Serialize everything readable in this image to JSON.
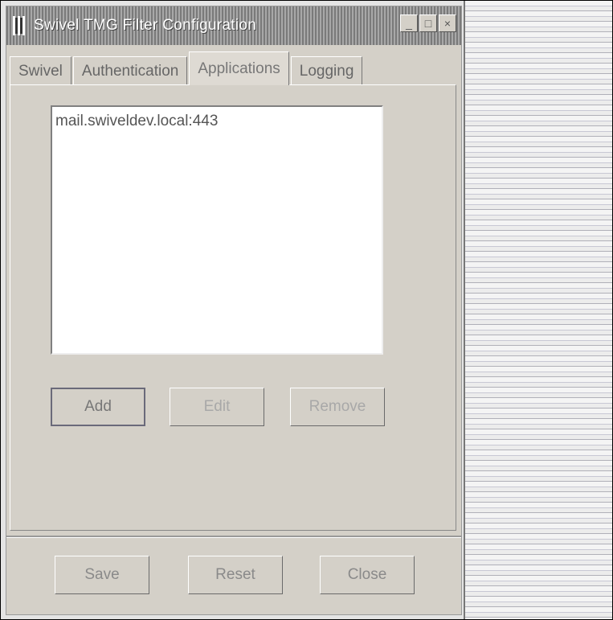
{
  "window": {
    "title": "Swivel TMG Filter Configuration",
    "controls": {
      "minimize": "_",
      "maximize": "□",
      "close": "×"
    }
  },
  "tabs": [
    {
      "label": "Swivel",
      "active": false
    },
    {
      "label": "Authentication",
      "active": false
    },
    {
      "label": "Applications",
      "active": true
    },
    {
      "label": "Logging",
      "active": false
    }
  ],
  "applications": {
    "list": [
      "mail.swiveldev.local:443"
    ],
    "buttons": {
      "add": "Add",
      "edit": "Edit",
      "remove": "Remove"
    }
  },
  "footer": {
    "save": "Save",
    "reset": "Reset",
    "close": "Close"
  },
  "colors": {
    "window_bg": "#d4d0c8",
    "titlebar": "#8a8a8a"
  }
}
